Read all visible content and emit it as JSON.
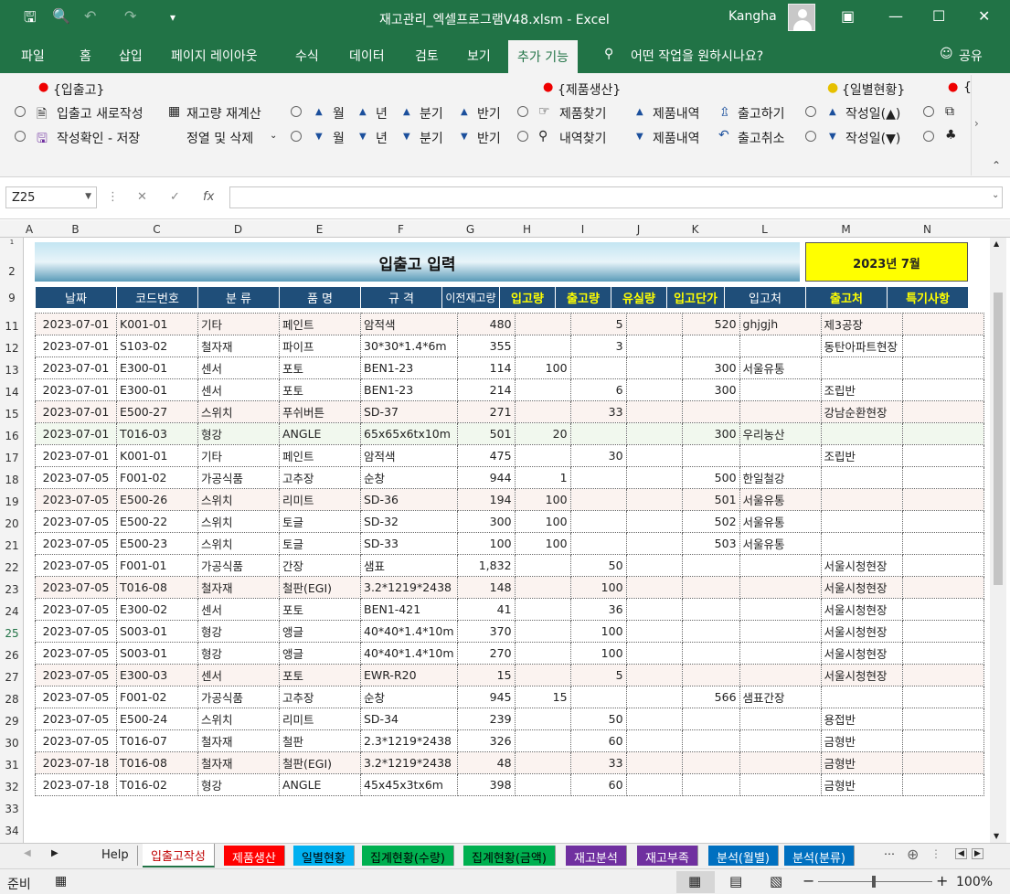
{
  "title_bar": {
    "document_title": "재고관리_엑셀프로그램V48.xlsm  -  Excel",
    "user_name": "Kangha"
  },
  "ribbon_tabs": [
    "파일",
    "홈",
    "삽입",
    "페이지 레이아웃",
    "수식",
    "데이터",
    "검토",
    "보기",
    "추가 기능"
  ],
  "tell_me": "어떤 작업을 원하시나요?",
  "share_label": "공유",
  "ribbon": {
    "group1_title": "{입출고}",
    "new_entry": "입출고 새로작성",
    "recalc": "재고량 재계산",
    "save_confirm": "작성확인 - 저장",
    "sort_delete": "정열 및 삭제",
    "month": "월",
    "year": "년",
    "quarter": "분기",
    "half": "반기",
    "group2_title": "{제품생산}",
    "find_product": "제품찾기",
    "find_history": "내역찾기",
    "product_list": "제품내역",
    "do_release": "출고하기",
    "cancel_release": "출고취소",
    "group3_title": "{일별현황}",
    "date_asc": "작성일(▲)",
    "date_desc": "작성일(▼)",
    "group4_title": "{"
  },
  "formula_bar": {
    "name_box": "Z25",
    "formula": ""
  },
  "columns": [
    "A",
    "B",
    "C",
    "D",
    "E",
    "F",
    "G",
    "H",
    "I",
    "J",
    "K",
    "L",
    "M",
    "N"
  ],
  "row_numbers": [
    "1",
    "2",
    "9",
    "11",
    "12",
    "13",
    "14",
    "15",
    "16",
    "17",
    "18",
    "19",
    "20",
    "21",
    "22",
    "23",
    "24",
    "25",
    "26",
    "27",
    "28",
    "29",
    "30",
    "31",
    "32",
    "33",
    "34"
  ],
  "sheet": {
    "title": "입출고 입력",
    "month_label": "2023년 7월",
    "headers": [
      "날짜",
      "코드번호",
      "분 류",
      "품 명",
      "규 격",
      "이전재고량",
      "입고량",
      "출고량",
      "유실량",
      "입고단가",
      "입고처",
      "출고처",
      "특기사항"
    ],
    "rows": [
      [
        "2023-07-01",
        "K001-01",
        "기타",
        "페인트",
        "암적색",
        "480",
        "",
        "5",
        "",
        "520",
        "ghjgjh",
        "제3공장",
        ""
      ],
      [
        "2023-07-01",
        "S103-02",
        "철자재",
        "파이프",
        "30*30*1.4*6m",
        "355",
        "",
        "3",
        "",
        "",
        "",
        "동탄아파트현장",
        ""
      ],
      [
        "2023-07-01",
        "E300-01",
        "센서",
        "포토",
        "BEN1-23",
        "114",
        "100",
        "",
        "",
        "300",
        "서울유통",
        "",
        ""
      ],
      [
        "2023-07-01",
        "E300-01",
        "센서",
        "포토",
        "BEN1-23",
        "214",
        "",
        "6",
        "",
        "300",
        "",
        "조립반",
        ""
      ],
      [
        "2023-07-01",
        "E500-27",
        "스위치",
        "푸쉬버튼",
        "SD-37",
        "271",
        "",
        "33",
        "",
        "",
        "",
        "강남순환현장",
        ""
      ],
      [
        "2023-07-01",
        "T016-03",
        "형강",
        "ANGLE",
        "65x65x6tx10m",
        "501",
        "20",
        "",
        "",
        "300",
        "우리농산",
        "",
        ""
      ],
      [
        "2023-07-01",
        "K001-01",
        "기타",
        "페인트",
        "암적색",
        "475",
        "",
        "30",
        "",
        "",
        "",
        "조립반",
        ""
      ],
      [
        "2023-07-05",
        "F001-02",
        "가공식품",
        "고추장",
        "순창",
        "944",
        "1",
        "",
        "",
        "500",
        "한일철강",
        "",
        ""
      ],
      [
        "2023-07-05",
        "E500-26",
        "스위치",
        "리미트",
        "SD-36",
        "194",
        "100",
        "",
        "",
        "501",
        "서울유통",
        "",
        ""
      ],
      [
        "2023-07-05",
        "E500-22",
        "스위치",
        "토글",
        "SD-32",
        "300",
        "100",
        "",
        "",
        "502",
        "서울유통",
        "",
        ""
      ],
      [
        "2023-07-05",
        "E500-23",
        "스위치",
        "토글",
        "SD-33",
        "100",
        "100",
        "",
        "",
        "503",
        "서울유통",
        "",
        ""
      ],
      [
        "2023-07-05",
        "F001-01",
        "가공식품",
        "간장",
        "샘표",
        "1,832",
        "",
        "50",
        "",
        "",
        "",
        "서울시청현장",
        ""
      ],
      [
        "2023-07-05",
        "T016-08",
        "철자재",
        "철판(EGI)",
        "3.2*1219*2438",
        "148",
        "",
        "100",
        "",
        "",
        "",
        "서울시청현장",
        ""
      ],
      [
        "2023-07-05",
        "E300-02",
        "센서",
        "포토",
        "BEN1-421",
        "41",
        "",
        "36",
        "",
        "",
        "",
        "서울시청현장",
        ""
      ],
      [
        "2023-07-05",
        "S003-01",
        "형강",
        "앵글",
        "40*40*1.4*10m",
        "370",
        "",
        "100",
        "",
        "",
        "",
        "서울시청현장",
        ""
      ],
      [
        "2023-07-05",
        "S003-01",
        "형강",
        "앵글",
        "40*40*1.4*10m",
        "270",
        "",
        "100",
        "",
        "",
        "",
        "서울시청현장",
        ""
      ],
      [
        "2023-07-05",
        "E300-03",
        "센서",
        "포토",
        "EWR-R20",
        "15",
        "",
        "5",
        "",
        "",
        "",
        "서울시청현장",
        ""
      ],
      [
        "2023-07-05",
        "F001-02",
        "가공식품",
        "고추장",
        "순창",
        "945",
        "15",
        "",
        "",
        "566",
        "샘표간장",
        "",
        ""
      ],
      [
        "2023-07-05",
        "E500-24",
        "스위치",
        "리미트",
        "SD-34",
        "239",
        "",
        "50",
        "",
        "",
        "",
        "용접반",
        ""
      ],
      [
        "2023-07-05",
        "T016-07",
        "철자재",
        "철판",
        "2.3*1219*2438",
        "326",
        "",
        "60",
        "",
        "",
        "",
        "금형반",
        ""
      ],
      [
        "2023-07-18",
        "T016-08",
        "철자재",
        "철판(EGI)",
        "3.2*1219*2438",
        "48",
        "",
        "33",
        "",
        "",
        "",
        "금형반",
        ""
      ],
      [
        "2023-07-18",
        "T016-02",
        "형강",
        "ANGLE",
        "45x45x3tx6m",
        "398",
        "",
        "60",
        "",
        "",
        "",
        "금형반",
        ""
      ]
    ]
  },
  "sheet_tabs": [
    {
      "label": "Help",
      "color": "#f0f0f0",
      "text": "#222"
    },
    {
      "label": "입출고작성",
      "color": "#ffffff",
      "text": "#c00000"
    },
    {
      "label": "제품생산",
      "color": "#ff0000",
      "text": "#ffffff"
    },
    {
      "label": "일별현황",
      "color": "#00b0f0",
      "text": "#000000"
    },
    {
      "label": "집계현황(수량)",
      "color": "#00b050",
      "text": "#000000"
    },
    {
      "label": "집계현황(금액)",
      "color": "#00b050",
      "text": "#000000"
    },
    {
      "label": "재고분석",
      "color": "#7030a0",
      "text": "#ffffff"
    },
    {
      "label": "재고부족",
      "color": "#7030a0",
      "text": "#ffffff"
    },
    {
      "label": "분석(월별)",
      "color": "#0070c0",
      "text": "#ffffff"
    },
    {
      "label": "분석(분류)",
      "color": "#0070c0",
      "text": "#ffffff"
    }
  ],
  "status": {
    "ready": "준비",
    "zoom": "100%"
  },
  "colors": {
    "excel_green": "#217346",
    "header_navy": "#1f4e79",
    "header_yellow_text": "#ffff00",
    "month_box": "#ffff00"
  }
}
